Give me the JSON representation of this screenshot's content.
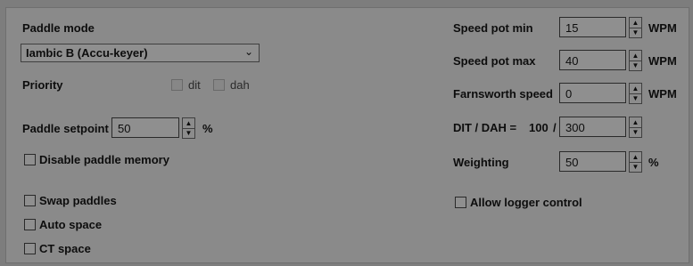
{
  "left": {
    "paddle_mode_label": "Paddle mode",
    "paddle_mode_value": "Iambic B  (Accu-keyer)",
    "priority_label": "Priority",
    "priority_dit": "dit",
    "priority_dah": "dah",
    "paddle_setpoint_label": "Paddle setpoint",
    "paddle_setpoint_value": "50",
    "paddle_setpoint_unit": "%",
    "disable_paddle_memory": "Disable paddle memory",
    "swap_paddles": "Swap paddles",
    "auto_space": "Auto space",
    "ct_space": "CT space"
  },
  "right": {
    "speed_pot_min_label": "Speed pot min",
    "speed_pot_min_value": "15",
    "speed_pot_max_label": "Speed pot max",
    "speed_pot_max_value": "40",
    "farnsworth_label": "Farnsworth speed",
    "farnsworth_value": "0",
    "wpm": "WPM",
    "dit_dah_label": "DIT / DAH =",
    "dit_value": "100",
    "dit_dah_sep": "/",
    "dah_value": "300",
    "weighting_label": "Weighting",
    "weighting_value": "50",
    "weighting_unit": "%",
    "allow_logger_control": "Allow logger control"
  }
}
